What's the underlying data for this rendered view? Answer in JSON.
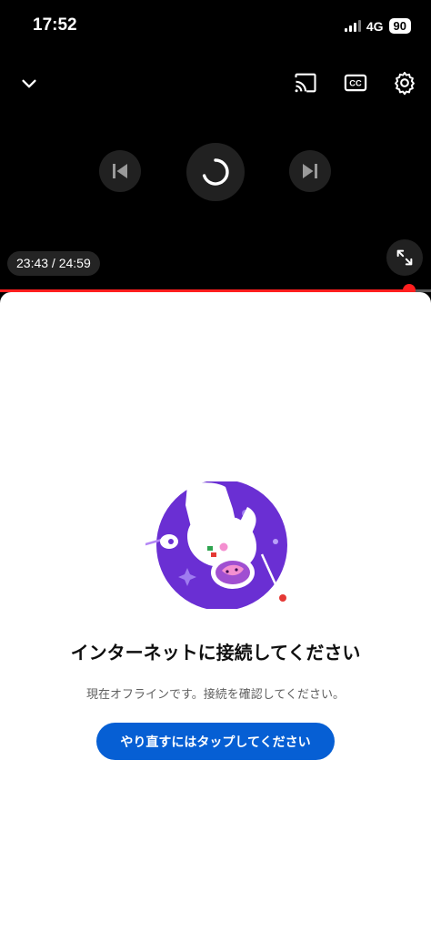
{
  "status": {
    "time": "17:52",
    "network": "4G",
    "battery": "90"
  },
  "player": {
    "time_display": "23:43 / 24:59",
    "progress_fraction": 0.949,
    "accent_color": "#ff1f1f",
    "icons": [
      "chevron-down-icon",
      "cast-icon",
      "captions-icon",
      "settings-icon",
      "previous-icon",
      "loading-spinner-icon",
      "next-icon",
      "fullscreen-icon"
    ]
  },
  "offline": {
    "title": "インターネットに接続してください",
    "message": "現在オフラインです。接続を確認してください。",
    "retry_label": "やり直すにはタップしてください",
    "button_color": "#065fd4"
  }
}
